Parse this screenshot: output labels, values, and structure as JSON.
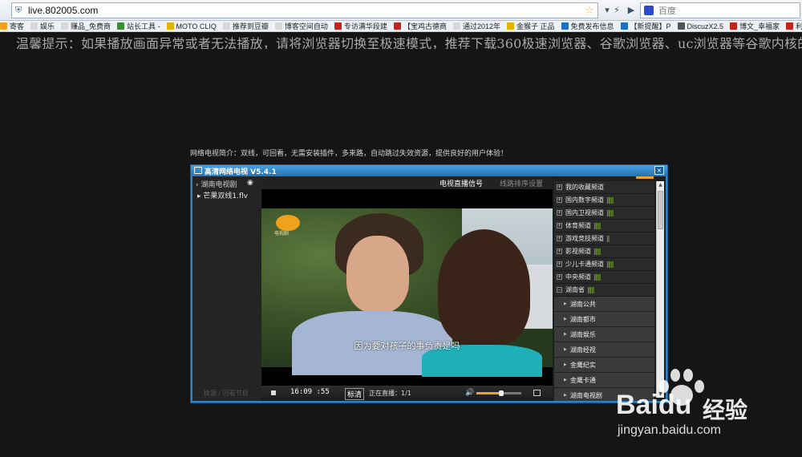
{
  "browser": {
    "url": "live.802005.com",
    "search_placeholder": "百度"
  },
  "bookmarks": [
    {
      "label": "寄客",
      "color": "#f2a01e"
    },
    {
      "label": "娱乐",
      "color": "#d8d8d8"
    },
    {
      "label": "赚品_免费商",
      "color": "#d8d8d8"
    },
    {
      "label": "站长工具 -",
      "color": "#3a8e3a"
    },
    {
      "label": "MOTO CLIQ",
      "color": "#e0b400"
    },
    {
      "label": "推荐到豆瓣",
      "color": "#d8d8d8"
    },
    {
      "label": "博客空间自动",
      "color": "#d8d8d8"
    },
    {
      "label": "专访满华段建",
      "color": "#c2231a"
    },
    {
      "label": "【宝鸡古德商",
      "color": "#c2231a"
    },
    {
      "label": "通过2012年",
      "color": "#d8d8d8"
    },
    {
      "label": "金猴子 正品",
      "color": "#e0b400"
    },
    {
      "label": "免费发布信息",
      "color": "#1d6fc2"
    },
    {
      "label": "【新提醒】P",
      "color": "#1d6fc2"
    },
    {
      "label": "DiscuzX2.5",
      "color": "#555555"
    },
    {
      "label": "博文_幸福家",
      "color": "#c2231a"
    },
    {
      "label": "利博亚洲-专",
      "color": "#c2231a"
    }
  ],
  "page": {
    "notice": "温馨提示：如果播放画面异常或者无法播放，请将浏览器切换至极速模式，推荐下载360极速浏览器、谷歌浏览器、uc浏览器等谷歌内核的浏",
    "intro": "网络电视简介：双线，可回看，无需安装插件，多来路，自动跳过失效资源，提供良好的用户体验！"
  },
  "player": {
    "title": "高清网络电视 V5.4.1",
    "close_label": "×",
    "current_channel": "湖南电视剧",
    "file": "芒果双线1.flv",
    "left_footer": "换源 / 回看节目",
    "tab_live": "电视直播信号",
    "tab_sort": "线路排序设置",
    "channel_logo_text": "电视剧",
    "subtitle": "因为要对孩子的事负责是吗",
    "time": "16:09 :55",
    "quality": "标清",
    "status": "正在直播：1/1",
    "volume": 0.55
  },
  "channels": [
    {
      "label": "我的收藏频道",
      "toggle": "+",
      "bars": ""
    },
    {
      "label": "国内数字频道",
      "toggle": "+",
      "bars": "|||||"
    },
    {
      "label": "国内卫视频道",
      "toggle": "+",
      "bars": "|||||"
    },
    {
      "label": "体育频道",
      "toggle": "+",
      "bars": "|||||"
    },
    {
      "label": "游戏竞技频道",
      "toggle": "+",
      "bars": "||"
    },
    {
      "label": "影视频道",
      "toggle": "+",
      "bars": "|||||"
    },
    {
      "label": "少儿卡通频道",
      "toggle": "+",
      "bars": "|||||"
    },
    {
      "label": "中央频道",
      "toggle": "+",
      "bars": "|||||"
    },
    {
      "label": "湖南省",
      "toggle": "−",
      "bars": "|||||"
    }
  ],
  "subchannels": [
    "湖南公共",
    "湖南都市",
    "湖南娱乐",
    "湖南经视",
    "金鹰纪实",
    "金鹰卡通",
    "湖南电视剧"
  ],
  "watermark": {
    "brand": "Baidu",
    "brand_cn": "经验",
    "domain": "jingyan.baidu.com"
  }
}
